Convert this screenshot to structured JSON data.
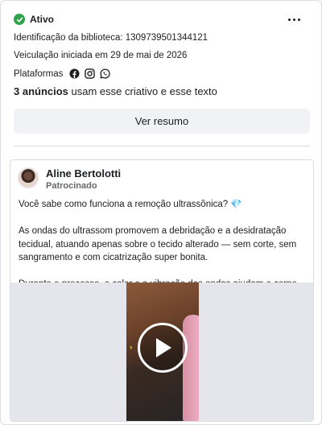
{
  "status": {
    "label": "Ativo",
    "color": "#31a24c",
    "icon": "check-circle-icon"
  },
  "menu": {
    "icon": "more-horizontal-icon"
  },
  "meta": {
    "library_id": "Identificação da biblioteca: 1309739501344121",
    "started": "Veiculação iniciada em 29 de mai de 2026",
    "platforms_label": "Plataformas",
    "platforms": [
      "facebook-icon",
      "instagram-icon",
      "whatsapp-icon"
    ]
  },
  "ads_count": {
    "bold": "3 anúncios",
    "rest": " usam esse criativo e esse texto"
  },
  "summary_button": "Ver resumo",
  "ad": {
    "author": "Aline Bertolotti",
    "sponsored": "Patrocinado",
    "body_line1": "Você sabe como funciona a remoção ultrassônica? 💎",
    "body_para2": "As ondas do ultrassom promovem a debridação e a desidratação tecidual, atuando apenas sobre o tecido alterado — sem corte, sem sangramento e com cicatrização super bonita.",
    "body_para3": "Durante o processo, o calor e a vibração das ondas ajudam o corpo a ...",
    "video": {
      "icon": "play-icon"
    }
  }
}
